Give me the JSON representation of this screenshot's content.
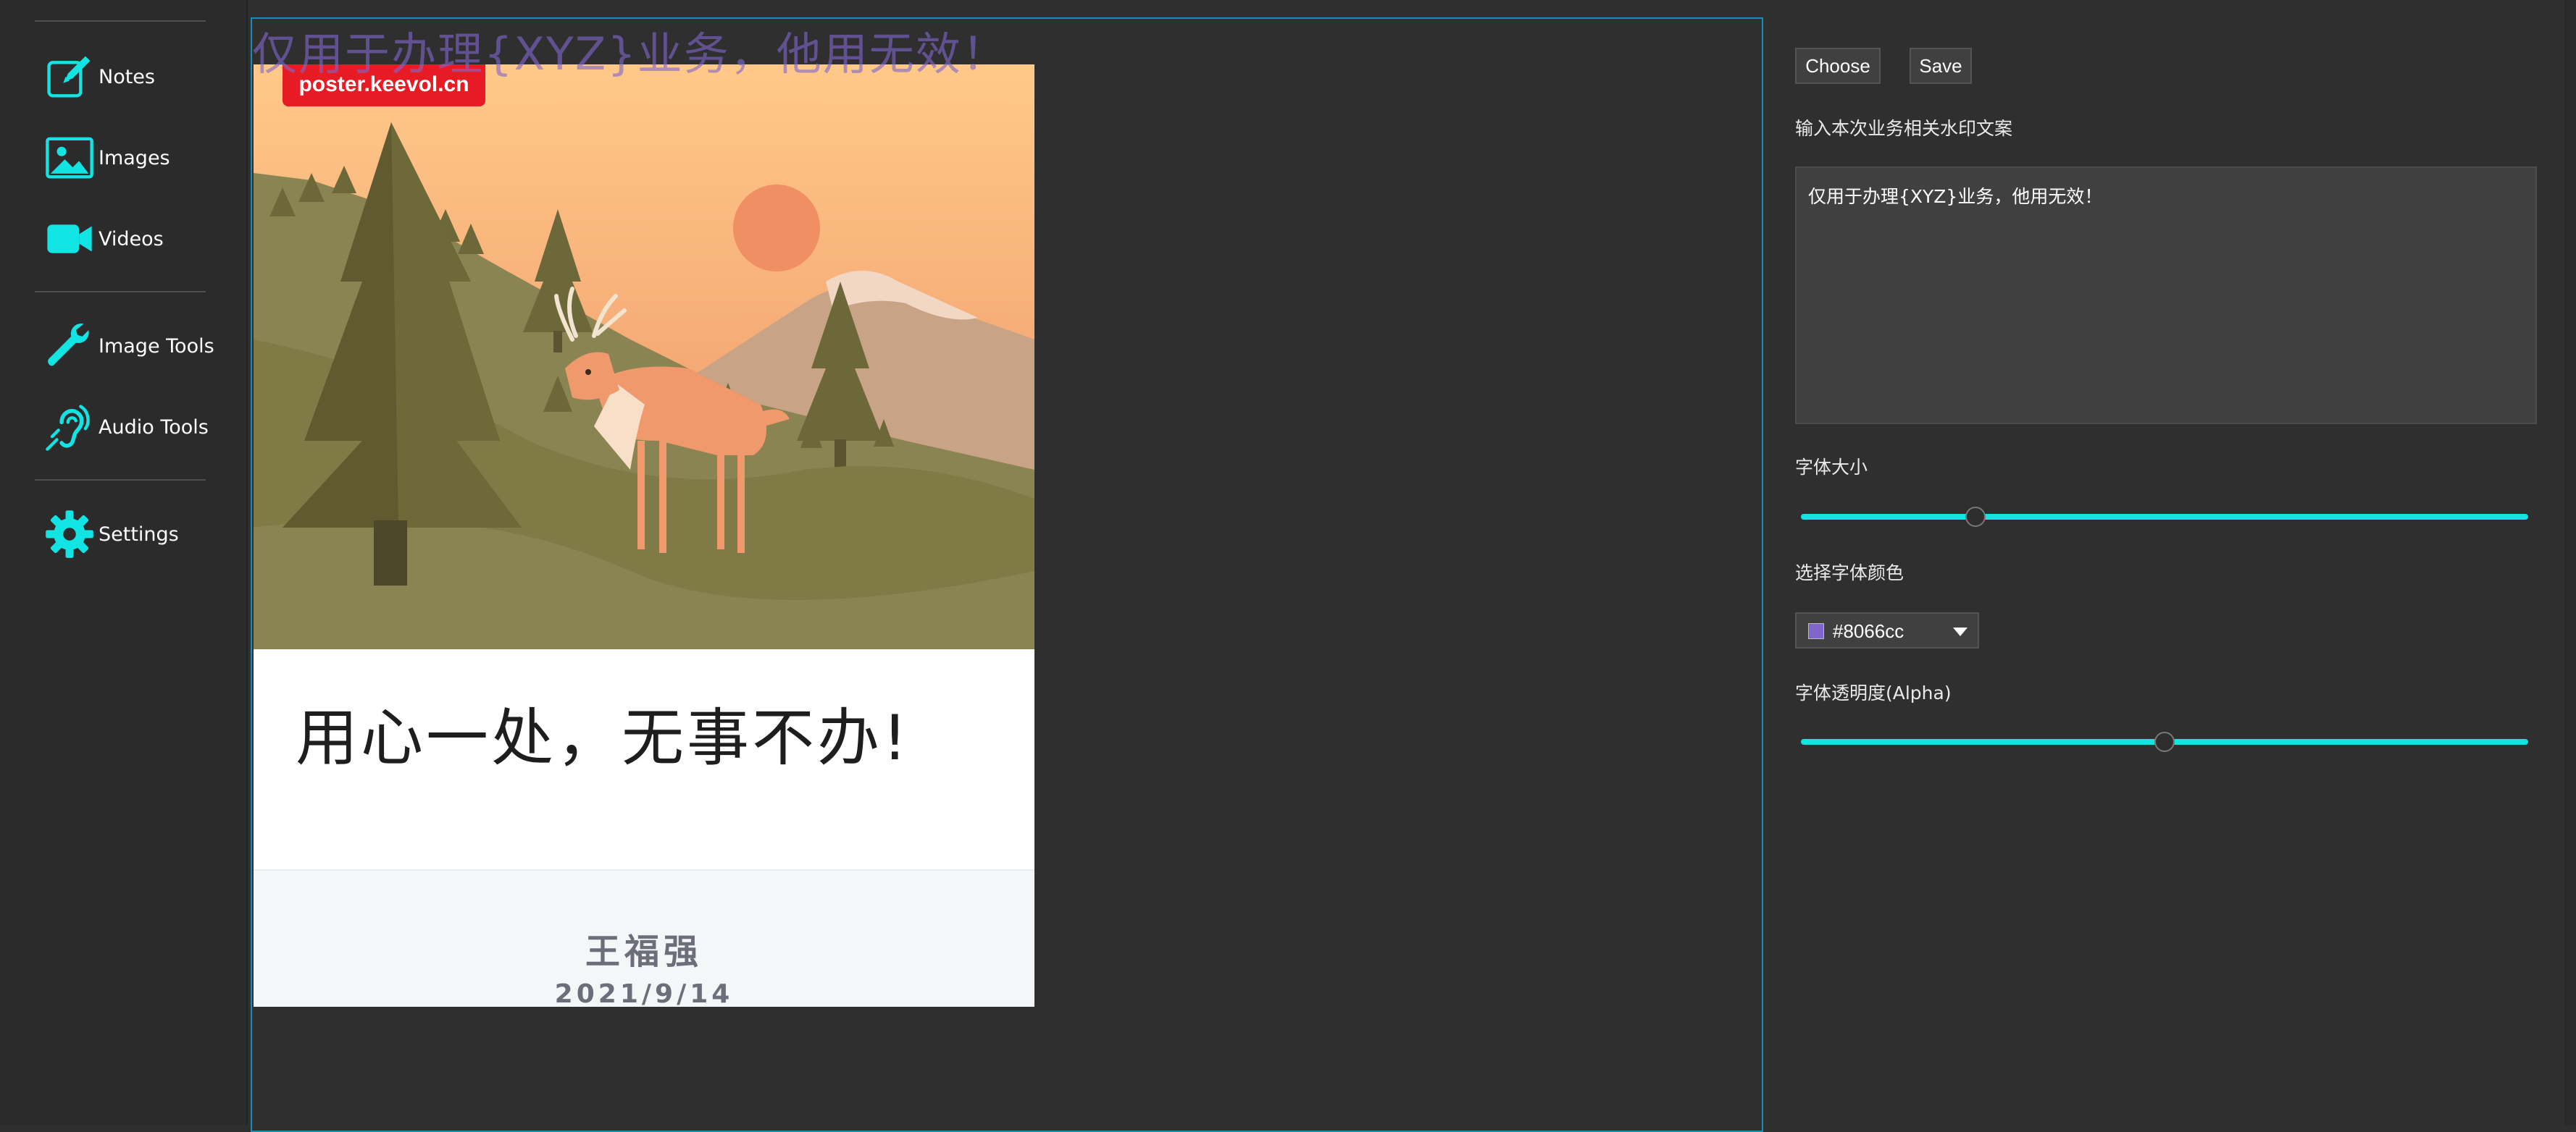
{
  "sidebar": {
    "items": [
      {
        "label": "Notes",
        "icon": "notes-icon"
      },
      {
        "label": "Images",
        "icon": "image-icon"
      },
      {
        "label": "Videos",
        "icon": "video-icon"
      },
      {
        "label": "Image Tools",
        "icon": "wrench-icon"
      },
      {
        "label": "Audio Tools",
        "icon": "hearing-icon"
      },
      {
        "label": "Settings",
        "icon": "gear-icon"
      }
    ]
  },
  "canvas": {
    "watermark_text": "仅用于办理{XYZ}业务，他用无效！",
    "poster": {
      "site_badge": "poster.keevol.cn",
      "headline": "用心一处，无事不办!",
      "author": "王福强",
      "date": "2021/9/14"
    }
  },
  "panel": {
    "choose_label": "Choose",
    "save_label": "Save",
    "watermark_label": "输入本次业务相关水印文案",
    "watermark_value": "仅用于办理{XYZ}业务，他用无效！",
    "font_size_label": "字体大小",
    "font_size_fraction": 0.24,
    "font_color_label": "选择字体颜色",
    "font_color_value": "#8066cc",
    "alpha_label": "字体透明度(Alpha)",
    "alpha_fraction": 0.5
  },
  "colors": {
    "accent": "#12e3e3",
    "watermark": "#8066cc",
    "badge": "#e71b23",
    "canvas_border": "#1a8bb8"
  }
}
